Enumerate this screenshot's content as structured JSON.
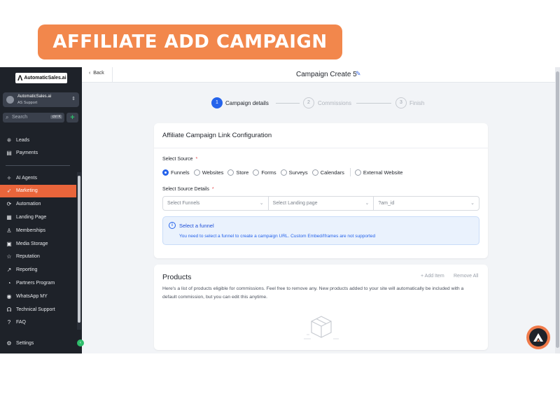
{
  "banner": {
    "text": "AFFILIATE ADD CAMPAIGN",
    "color": "#f2874c"
  },
  "sidebar": {
    "logo_text": "AutomaticSales.ai",
    "account": {
      "name": "AutomaticSales.ai",
      "sub": "AS Support"
    },
    "search": {
      "placeholder": "Search",
      "shortcut": "ctrl K"
    },
    "items_top": [
      {
        "label": "Leads",
        "icon": "leads-icon"
      },
      {
        "label": "Payments",
        "icon": "payments-icon"
      }
    ],
    "items": [
      {
        "label": "AI Agents",
        "icon": "ai-agents-icon"
      },
      {
        "label": "Marketing",
        "icon": "marketing-icon",
        "active": true
      },
      {
        "label": "Automation",
        "icon": "automation-icon"
      },
      {
        "label": "Landing Page",
        "icon": "landing-page-icon"
      },
      {
        "label": "Memberships",
        "icon": "memberships-icon"
      },
      {
        "label": "Media Storage",
        "icon": "media-storage-icon"
      },
      {
        "label": "Reputation",
        "icon": "reputation-icon"
      },
      {
        "label": "Reporting",
        "icon": "reporting-icon"
      },
      {
        "label": "Partners Program",
        "icon": "partners-program-icon"
      },
      {
        "label": "WhatsApp MY",
        "icon": "whatsapp-icon"
      },
      {
        "label": "Technical Support",
        "icon": "technical-support-icon"
      },
      {
        "label": "FAQ",
        "icon": "faq-icon"
      }
    ],
    "settings_label": "Settings",
    "active_color": "#e9653b"
  },
  "header": {
    "back_label": "Back",
    "title": "Campaign Create 5"
  },
  "stepper": {
    "steps": [
      {
        "num": "1",
        "label": "Campaign details",
        "active": true
      },
      {
        "num": "2",
        "label": "Commissions",
        "active": false
      },
      {
        "num": "3",
        "label": "Finish",
        "active": false
      }
    ]
  },
  "config_card": {
    "title": "Affiliate Campaign Link Configuration",
    "source_label": "Select Source",
    "sources": [
      "Funnels",
      "Websites",
      "Store",
      "Forms",
      "Surveys",
      "Calendars",
      "External Website"
    ],
    "selected_source": "Funnels",
    "details_label": "Select Source Details",
    "required_mark": "*",
    "selects": [
      {
        "placeholder": "Select Funnels"
      },
      {
        "placeholder": "Select Landing page"
      },
      {
        "value": "?am_id"
      }
    ],
    "info": {
      "heading": "Select a funnel",
      "body": "You need to select a funnel to create a campaign URL. Custom Embed/Iframes are not supported"
    }
  },
  "products_card": {
    "title": "Products",
    "add_label": "+ Add Item",
    "remove_label": "Remove All",
    "description": "Here's a list of products eligible for commissions. Feel free to remove any. New products added to your site will automatically be included with a default commission, but you can edit this anytime."
  },
  "colors": {
    "primary": "#2563eb",
    "sidebar_bg": "#1e2229"
  }
}
